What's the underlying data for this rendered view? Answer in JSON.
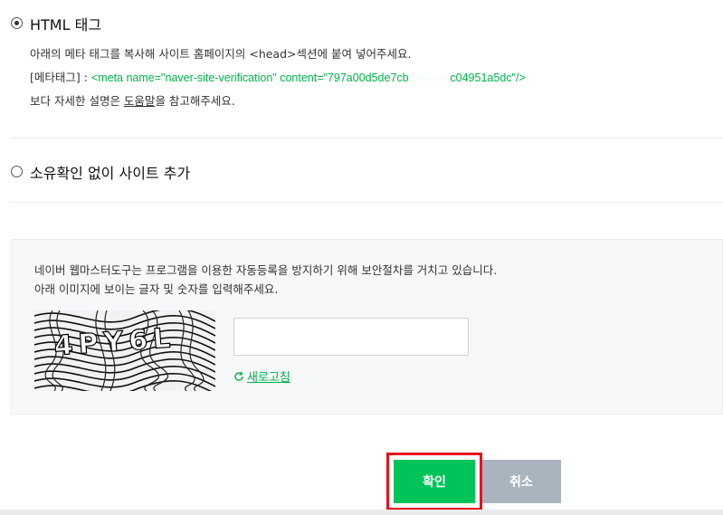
{
  "options": {
    "html_tag": {
      "label": "HTML 태그",
      "checked": true,
      "instruction": "아래의 메타 태그를 복사해 사이트 홈페이지의 <head>섹션에 붙여 넣어주세요.",
      "meta_prefix": "[메타태그] : ",
      "meta_code": "<meta name=\"naver-site-verification\" content=\"797a00d5de7cb",
      "meta_code_end": "c04951a5dc\"/>",
      "help_prefix": "보다 자세한 설명은 ",
      "help_link": "도움말",
      "help_suffix": "을 참고해주세요."
    },
    "no_verify": {
      "label": "소유확인 없이 사이트 추가",
      "checked": false
    }
  },
  "captcha": {
    "notice_line1": "네이버 웹마스터도구는 프로그램을 이용한 자동등록을 방지하기 위해 보안절차를 거치고 있습니다.",
    "notice_line2": "아래 이미지에 보이는 글자 및 숫자를 입력해주세요.",
    "input_value": "",
    "image_text": "4PY6L",
    "refresh_label": "새로고침"
  },
  "buttons": {
    "confirm_label": "확인",
    "cancel_label": "취소"
  },
  "colors": {
    "accent_green": "#00c35a",
    "link_green": "#00b34a",
    "cancel_gray": "#aab4be",
    "highlight_red": "#e8121d"
  }
}
